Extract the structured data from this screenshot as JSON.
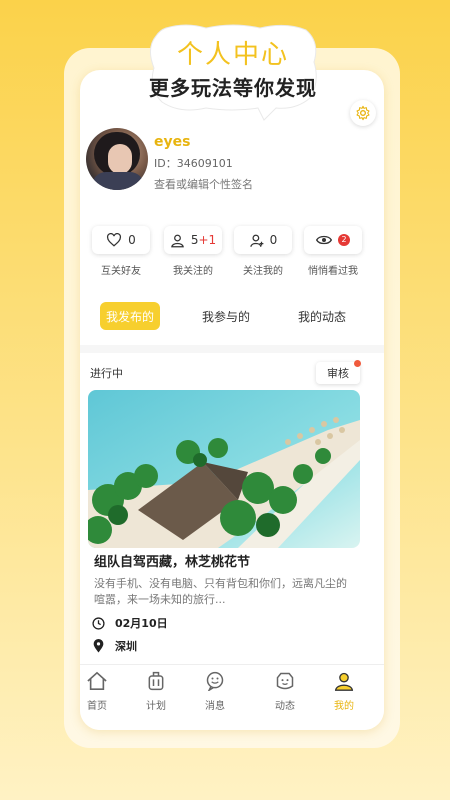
{
  "promo": {
    "title": "个人中心",
    "subtitle": "更多玩法等你发现"
  },
  "profile": {
    "name": "eyes",
    "id_text": "ID：34609101",
    "signature_hint": "查看或编辑个性签名"
  },
  "stats": [
    {
      "count": "0",
      "label": "互关好友",
      "icon": "heart-icon"
    },
    {
      "count": "5",
      "extra": "+1",
      "label": "我关注的",
      "icon": "user-icon"
    },
    {
      "count": "0",
      "label": "关注我的",
      "icon": "user-follow-icon"
    },
    {
      "count": "2",
      "label": "悄悄看过我",
      "icon": "eye-icon"
    }
  ],
  "tabs": [
    {
      "label": "我发布的",
      "active": true
    },
    {
      "label": "我参与的"
    },
    {
      "label": "我的动态"
    }
  ],
  "post": {
    "status": "进行中",
    "review_label": "审核",
    "title": "组队自驾西藏，林芝桃花节",
    "description": "没有手机、没有电脑、只有背包和你们，远离凡尘的喧嚣，来一场未知的旅行...",
    "date": "02月10日",
    "location": "深圳"
  },
  "bottom_nav": [
    {
      "label": "首页",
      "icon": "home-icon"
    },
    {
      "label": "计划",
      "icon": "luggage-icon"
    },
    {
      "label": "消息",
      "icon": "message-icon"
    },
    {
      "label": "动态",
      "icon": "moments-icon"
    },
    {
      "label": "我的",
      "icon": "profile-icon",
      "active": true
    }
  ],
  "colors": {
    "accent": "#f7cf2e",
    "accent_text": "#e8b40f",
    "badge": "#e53935"
  }
}
